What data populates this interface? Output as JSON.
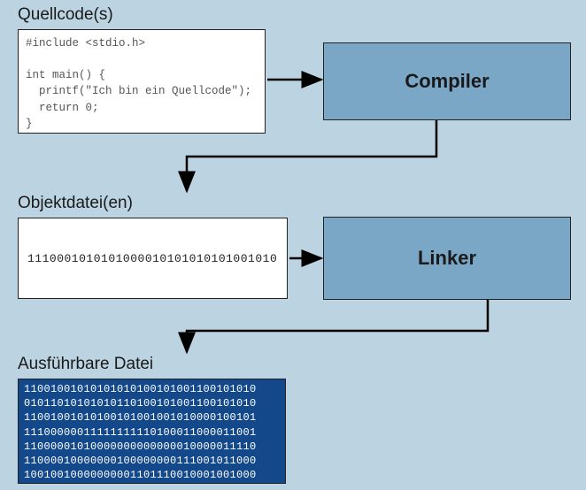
{
  "labels": {
    "source_title": "Quellcode(s)",
    "object_title": "Objektdatei(en)",
    "exe_title": "Ausführbare Datei",
    "compiler": "Compiler",
    "linker": "Linker"
  },
  "source_code": {
    "line1": "#include <stdio.h>",
    "line2": "",
    "line3": "int main() {",
    "line4": "  printf(\"Ich bin ein Quellcode\");",
    "line5": "  return 0;",
    "line6": "}"
  },
  "object_bits": "1110001010101000010101010101001010",
  "exe_bits": {
    "r1": "11001001010101010100101001100101010",
    "r2": "01011010101010110100101001100101010",
    "r3": "11001001010100101001001010000100101",
    "r4": "11100000011111111110100011000011001",
    "r5": "11000001010000000000000010000011110",
    "r6": "11000010000000100000000111001011000",
    "r7": "10010010000000001101110010001001000"
  }
}
